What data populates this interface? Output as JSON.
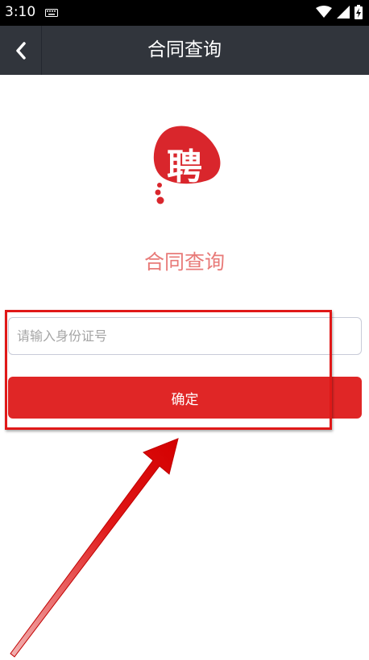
{
  "status_bar": {
    "time": "3:10",
    "icons": [
      "keyboard-icon",
      "wifi-icon",
      "signal-icon",
      "battery-icon"
    ]
  },
  "app_bar": {
    "title": "合同查询",
    "back_icon": "chevron-left-icon"
  },
  "logo": {
    "character": "聘",
    "color": "#d9262c"
  },
  "form": {
    "heading": "合同查询",
    "id_input": {
      "placeholder": "请输入身份证号",
      "value": ""
    },
    "confirm_label": "确定"
  },
  "colors": {
    "app_bar_bg": "#31353c",
    "accent_red": "#e02626",
    "heading_pink": "#e87a78",
    "annotation_red": "#e01818"
  }
}
